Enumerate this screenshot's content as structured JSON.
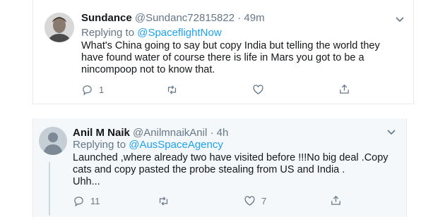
{
  "tweets": [
    {
      "name": "Sundance",
      "handle": "@Sundanc72815822",
      "separator": "·",
      "time": "49m",
      "replying_prefix": "Replying to ",
      "replying_to": "@SpaceflightNow",
      "text": "What's China going to say but copy India but telling the world they\nhave found water of course there is life in Mars you got to be a\nnincompoop not to know that.",
      "reply_count": "1",
      "retweet_count": "",
      "like_count": ""
    },
    {
      "name": "Anil M Naik",
      "handle": "@AnilmnaikAnil",
      "separator": "·",
      "time": "4h",
      "replying_prefix": "Replying to ",
      "replying_to": "@AusSpaceAgency",
      "text": "Launched ,where already two have visited before !!!No big deal .Copy\ncats and copy pasted the probe stealing from US and India .\nUhh...",
      "reply_count": "11",
      "retweet_count": "",
      "like_count": "7"
    }
  ],
  "icons": {
    "reply": "reply-icon",
    "retweet": "retweet-icon",
    "like": "heart-icon",
    "share": "share-icon",
    "caret": "chevron-down-icon"
  },
  "colors": {
    "link": "#1da1f2",
    "secondary_text": "#657786",
    "border": "#e6ecf0",
    "highlight_bg": "#f5f8fa"
  }
}
